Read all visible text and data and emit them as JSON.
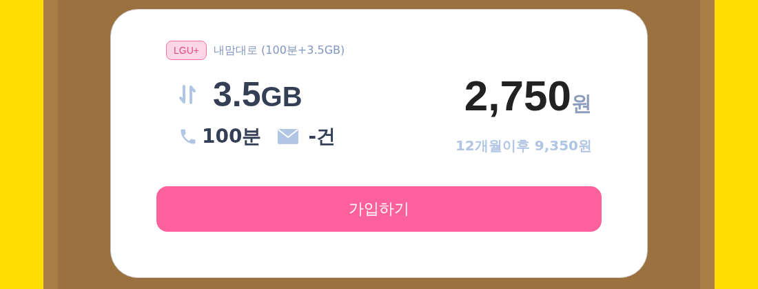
{
  "plan": {
    "carrier": "LGU+",
    "name": "내맘대로 (100분+3.5GB)",
    "data_amount": "3.5",
    "data_unit": "GB",
    "calls": "100분",
    "sms": "-건",
    "price": "2,750",
    "price_unit": "원",
    "later_price": "12개월이후 9,350원"
  },
  "button": {
    "label": "가입하기"
  }
}
